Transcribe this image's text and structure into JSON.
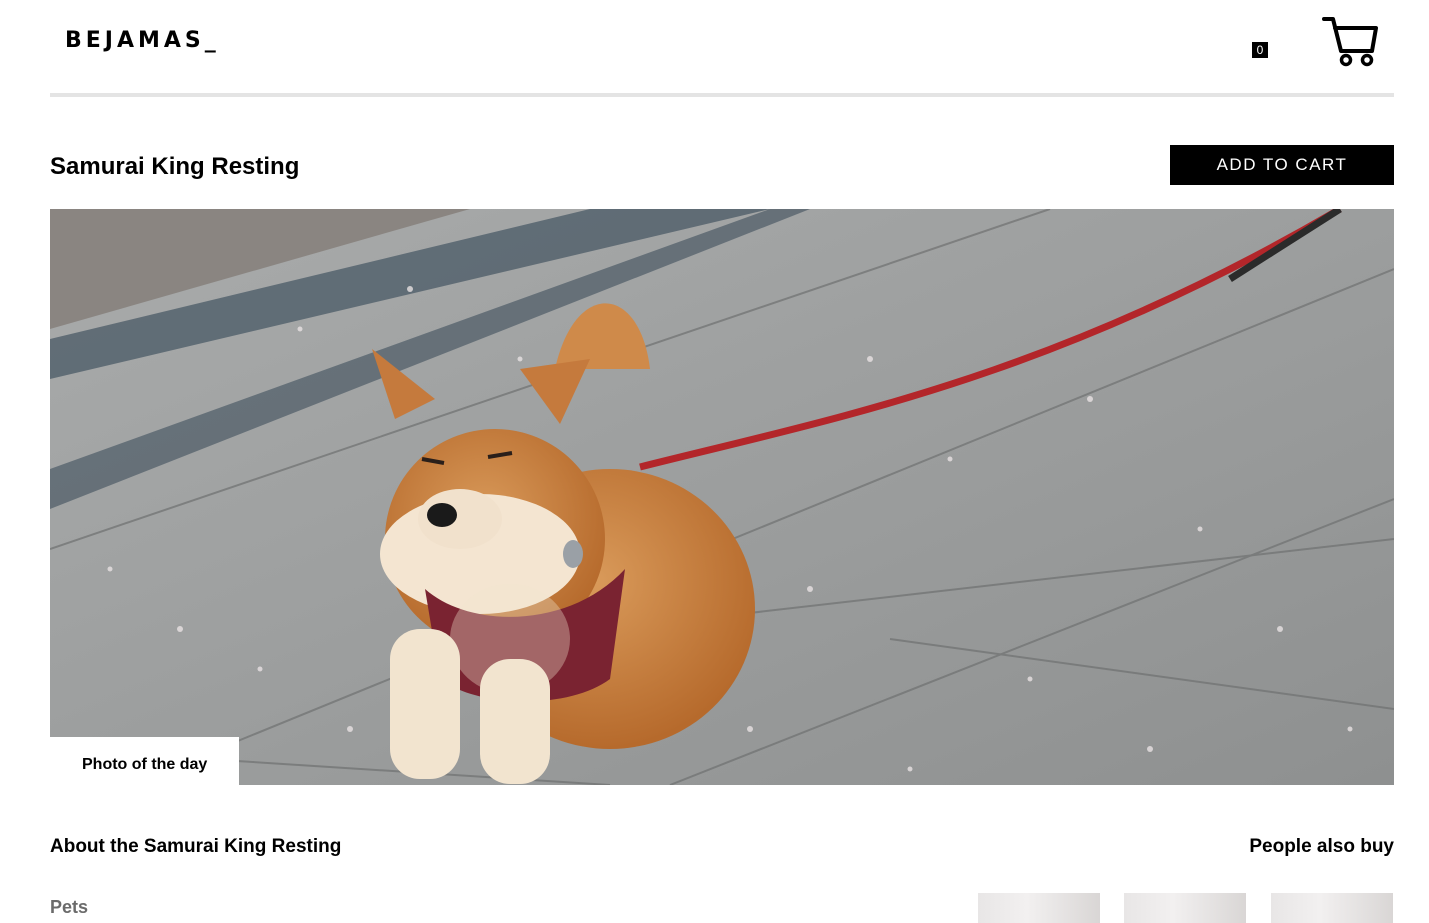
{
  "header": {
    "logo": "BEJAMAS_",
    "cart_count": "0",
    "cart_icon": "shopping-cart-icon"
  },
  "product": {
    "title": "Samurai King Resting",
    "add_to_cart_label": "ADD TO CART",
    "photo_badge": "Photo of the day",
    "photo_subject": "shiba-inu-dog-photo"
  },
  "about": {
    "title": "About the Samurai King Resting",
    "category": "Pets"
  },
  "recommendations": {
    "title": "People also buy",
    "items": [
      {
        "image": "recommended-product-image"
      },
      {
        "image": "recommended-product-image"
      },
      {
        "image": "recommended-product-image"
      }
    ]
  },
  "colors": {
    "accent": "#000000",
    "divider": "#e4e4e4",
    "category_text": "#6b6b6b"
  }
}
